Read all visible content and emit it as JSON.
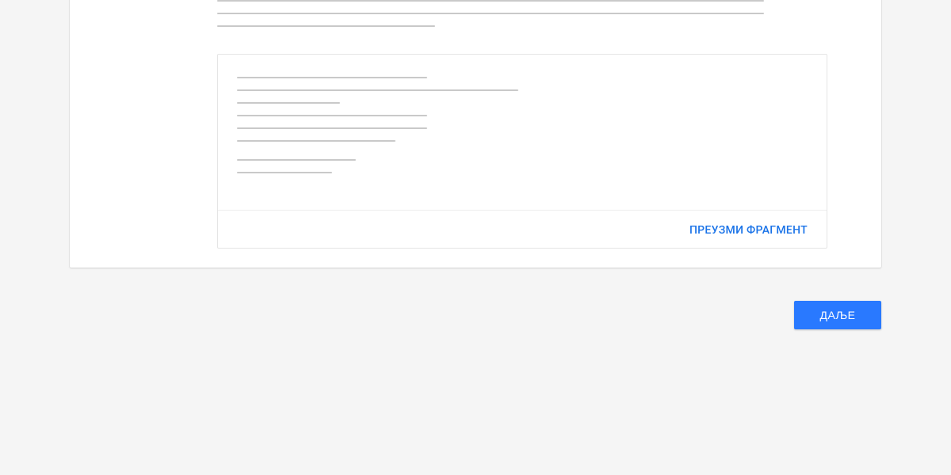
{
  "codeBox": {
    "downloadLabel": "ПРЕУЗМИ ФРАГМЕНТ"
  },
  "actions": {
    "nextLabel": "ДАЉЕ"
  }
}
